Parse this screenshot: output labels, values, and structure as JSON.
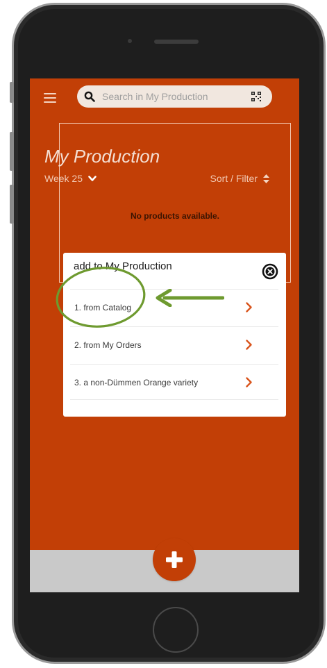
{
  "search": {
    "placeholder": "Search in My Production"
  },
  "header": {
    "title": "My Production",
    "week_label": "Week 25",
    "sort_label": "Sort / Filter"
  },
  "empty_state": {
    "message": "No products available."
  },
  "modal": {
    "title": "add to My Production",
    "options": [
      {
        "label": "1. from Catalog"
      },
      {
        "label": "2. from My Orders"
      },
      {
        "label": "3. a non-Dümmen Orange variety"
      }
    ]
  },
  "icons": {
    "menu": "hamburger-icon",
    "search": "search-icon",
    "qr": "qr-code-icon",
    "week": "chevron-down-icon",
    "sort": "sort-icon",
    "close": "close-icon",
    "option": "chevron-right-icon",
    "add": "plus-icon"
  },
  "colors": {
    "primary": "#c23f06",
    "annotation": "#6e9a2f",
    "bottom_bar": "#c9c9c9"
  }
}
